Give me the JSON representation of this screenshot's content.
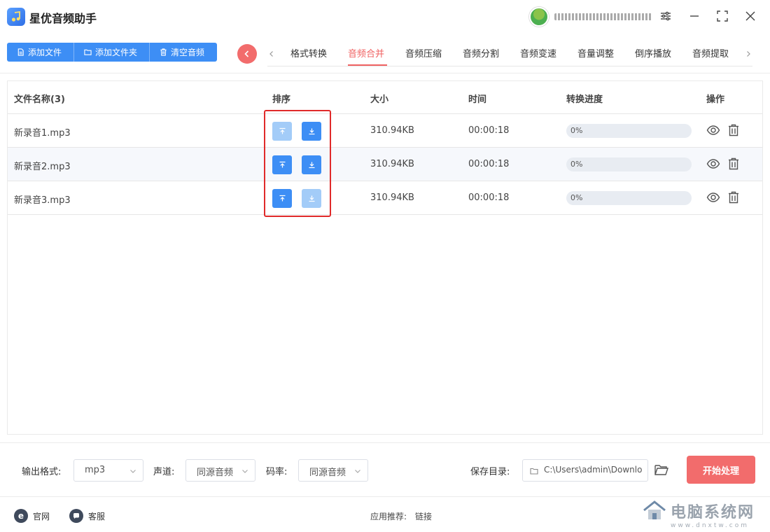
{
  "app": {
    "title": "星优音频助手"
  },
  "toolbar": {
    "add_file": "添加文件",
    "add_folder": "添加文件夹",
    "clear": "清空音频"
  },
  "tabs": [
    "格式转换",
    "音频合并",
    "音频压缩",
    "音频分割",
    "音频变速",
    "音量调整",
    "倒序播放",
    "音频提取"
  ],
  "active_tab": "音频合并",
  "table": {
    "headers": {
      "name": "文件名称(3)",
      "sort": "排序",
      "size": "大小",
      "time": "时间",
      "progress": "转换进度",
      "ops": "操作"
    },
    "rows": [
      {
        "name": "新录音1.mp3",
        "size": "310.94KB",
        "time": "00:00:18",
        "progress_label": "0%",
        "progress": 0
      },
      {
        "name": "新录音2.mp3",
        "size": "310.94KB",
        "time": "00:00:18",
        "progress_label": "0%",
        "progress": 0
      },
      {
        "name": "新录音3.mp3",
        "size": "310.94KB",
        "time": "00:00:18",
        "progress_label": "0%",
        "progress": 0
      }
    ]
  },
  "settings": {
    "format_label": "输出格式:",
    "format_value": "mp3",
    "channel_label": "声道:",
    "channel_value": "同源音频",
    "bitrate_label": "码率:",
    "bitrate_value": "同源音频",
    "save_label": "保存目录:",
    "save_path": "C:\\Users\\admin\\Downlo",
    "start_button": "开始处理"
  },
  "footer": {
    "official": "官网",
    "service": "客服",
    "recommend_label": "应用推荐:",
    "recommend_link": "链接"
  },
  "watermark": {
    "title": "电脑系统网",
    "url": "www.dnxtw.com"
  },
  "colors": {
    "accent_blue": "#3d8ef5",
    "accent_red": "#f26c6c",
    "highlight": "#e02a2a"
  }
}
